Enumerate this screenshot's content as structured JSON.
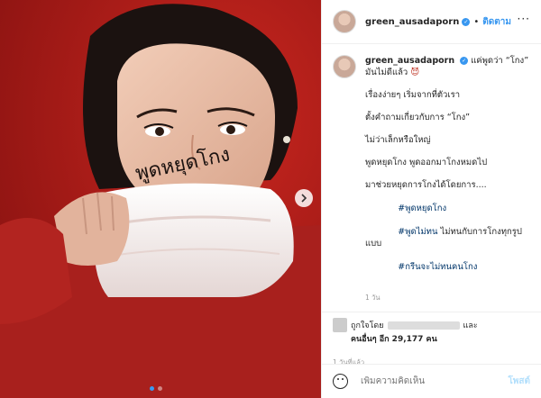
{
  "post": {
    "username": "green_ausadaporn",
    "follow_label": "ติดตาม",
    "face_text": "พูดหยุดโกง",
    "caption": {
      "line1": "แค่พูดว่า “โกง”",
      "line2": "มันไม่ดีแล้ว",
      "p1": "เรื่องง่ายๆ เริ่มจากที่ตัวเรา",
      "p2": "ตั้งคำถามเกี่ยวกับการ “โกง”",
      "p3": "ไม่ว่าเล็กหรือใหญ่",
      "p4": "พูดหยุดโกง พูดออกมาโกงหมดไป",
      "p5": "มาช่วยหยุดการโกงได้โดยการ....",
      "tag1": "#พูดหยุดโกง",
      "tag2": "#พูดไม่ทน",
      "tag2_suffix": " ไม่ทนกับการโกงทุกรูปแบบ",
      "tag3": "#กรีนจะไม่ทนคนโกง"
    },
    "comment_age": "1 วัน",
    "likes": {
      "liked_by": "ถูกใจโดย",
      "and": "และ",
      "others": "คนอื่นๆ อีก 29,177 คน"
    },
    "time_ago": "1 วันที่แล้ว",
    "comment_placeholder": "เพิ่มความคิดเห็น",
    "post_label": "โพสต์"
  },
  "carousel": {
    "current": 1,
    "total": 2
  },
  "colors": {
    "accent": "#3897f0",
    "background_red": "#b31d1c"
  }
}
